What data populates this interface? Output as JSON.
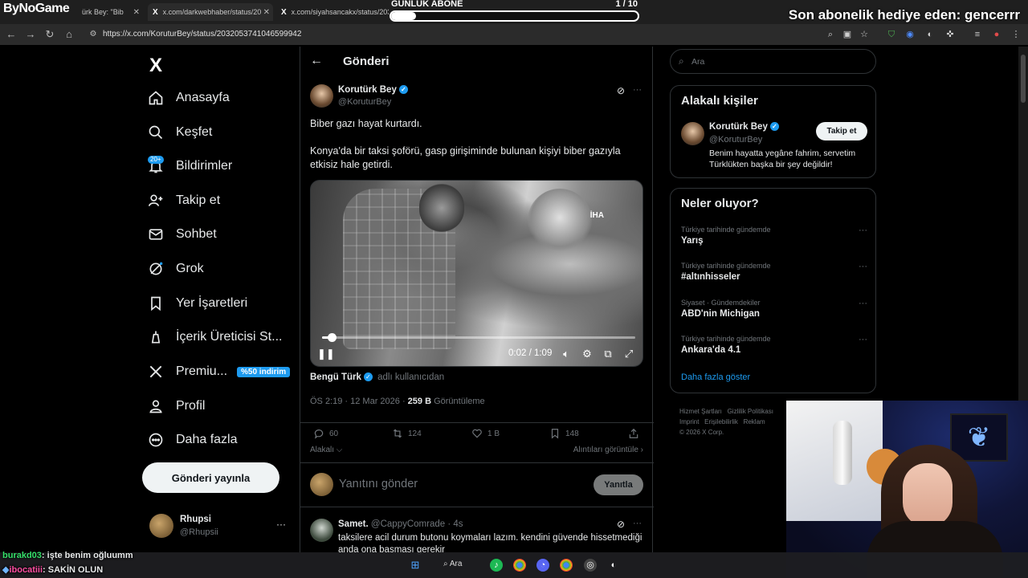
{
  "browser": {
    "tabs": [
      {
        "icon": "X",
        "title": "ürk Bey: \"Bib"
      },
      {
        "icon": "X",
        "title": "x.com/darkwebhaber/status/20"
      },
      {
        "icon": "X",
        "title": "x.com/siyahsancakx/status/203"
      },
      {
        "icon": "X",
        "title": "x.com/gerceklerfaktl/status/20"
      }
    ],
    "url": "https://x.com/KoruturBey/status/2032053741046599942"
  },
  "overlay": {
    "brand": "ByNoGame",
    "goal_title": "GÜNLÜK ABONE",
    "goal_count": "1 / 10",
    "goal_progress": 0.1,
    "sub_gift": "Son abonelik hediye eden: gencerrr"
  },
  "nav": {
    "logo": "X",
    "notif_badge": "20+",
    "items": [
      {
        "label": "Anasayfa",
        "icon": "home-icon"
      },
      {
        "label": "Keşfet",
        "icon": "search-icon"
      },
      {
        "label": "Bildirimler",
        "icon": "bell-icon"
      },
      {
        "label": "Takip et",
        "icon": "add-person-icon"
      },
      {
        "label": "Sohbet",
        "icon": "mail-icon"
      },
      {
        "label": "Grok",
        "icon": "grok-icon"
      },
      {
        "label": "Yer İşaretleri",
        "icon": "bookmark-icon"
      },
      {
        "label": "İçerik Üreticisi St...",
        "icon": "creator-icon"
      },
      {
        "label": "Premiu...",
        "icon": "x-icon"
      },
      {
        "label": "Profil",
        "icon": "person-icon"
      },
      {
        "label": "Daha fazla",
        "icon": "more-circle-icon"
      }
    ],
    "premium_badge": "%50 indirim",
    "post_button": "Gönderi yayınla",
    "account": {
      "name": "Rhupsi",
      "handle": "@Rhupsii",
      "more": "···"
    }
  },
  "main": {
    "header_title": "Gönderi",
    "tweet": {
      "author_name": "Korutürk Bey",
      "author_handle": "@KoruturBey",
      "more": "···",
      "text_line1": "Biber gazı hayat kurtardı.",
      "text_line2": "Konya'da bir taksi şoförü, gasp girişiminde bulunan kişiyi biber gazıyla etkisiz hale getirdi.",
      "video": {
        "watermark": "İHA",
        "time": "0:02 / 1:09",
        "progress": 0.03
      },
      "source_name": "Bengü Türk",
      "source_suffix": "adlı kullanıcıdan",
      "meta_time": "ÖS 2:19 · 12 Mar 2026 · ",
      "meta_views": "259 B",
      "meta_views_label": " Görüntüleme",
      "actions": {
        "replies": "60",
        "reposts": "124",
        "likes": "1 B",
        "bookmarks": "148"
      },
      "relevant": "Alakalı",
      "quotes_link": "Alıntıları görüntüle"
    },
    "reply_box": {
      "placeholder": "Yanıtını gönder",
      "button": "Yanıtla"
    },
    "reply": {
      "name": "Samet.",
      "handle": "@CappyComrade",
      "time": "· 4s",
      "more": "···",
      "text": "taksilere acil durum butonu koymaları lazım. kendini güvende hissetmediği anda ona basması gerekir"
    }
  },
  "right": {
    "search_placeholder": "Ara",
    "related_title": "Alakalı kişiler",
    "related": {
      "name": "Korutürk Bey",
      "handle": "@KoruturBey",
      "follow": "Takip et",
      "bio": "Benim hayatta yegâne fahrim, servetim Türklükten başka bir şey değildir!"
    },
    "trends_title": "Neler oluyor?",
    "trends": [
      {
        "category": "Türkiye tarihinde gündemde",
        "name": "Yarış"
      },
      {
        "category": "Türkiye tarihinde gündemde",
        "name": "#altınhisseler"
      },
      {
        "category": "Siyaset · Gündemdekiler",
        "name": "ABD'nin Michigan"
      },
      {
        "category": "Türkiye tarihinde gündemde",
        "name": "Ankara'da 4.1"
      }
    ],
    "trend_more": "···",
    "show_more": "Daha fazla göster",
    "footer": {
      "line1a": "Hizmet Şartları",
      "line1b": "Gizlilik Politikası",
      "line2a": "Imprint",
      "line2b": "Erişilebilirlik",
      "line2c": "Reklam",
      "copyright": "© 2026 X Corp."
    }
  },
  "chat": [
    {
      "user": "burakd03",
      "message": ": işte benim oğluumm"
    },
    {
      "user": "ibocatiii",
      "message": ": SAKİN OLUN"
    }
  ],
  "taskbar": {
    "search": "Ara"
  }
}
